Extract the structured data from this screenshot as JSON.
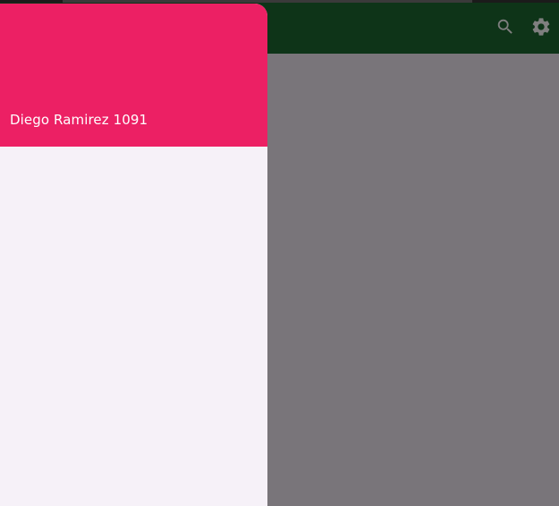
{
  "status_bar": {},
  "app_bar": {
    "actions": [
      {
        "icon": "search-icon"
      },
      {
        "icon": "gear-icon"
      }
    ]
  },
  "drawer": {
    "header": {
      "user_name": "Diego Ramirez 1091"
    }
  },
  "colors": {
    "app_bar_bg": "#0e3418",
    "drawer_header_bg": "#ec2064",
    "drawer_bg": "#f6f1f8",
    "scrim": "#79757a",
    "icon_color": "#7f7f7f"
  }
}
